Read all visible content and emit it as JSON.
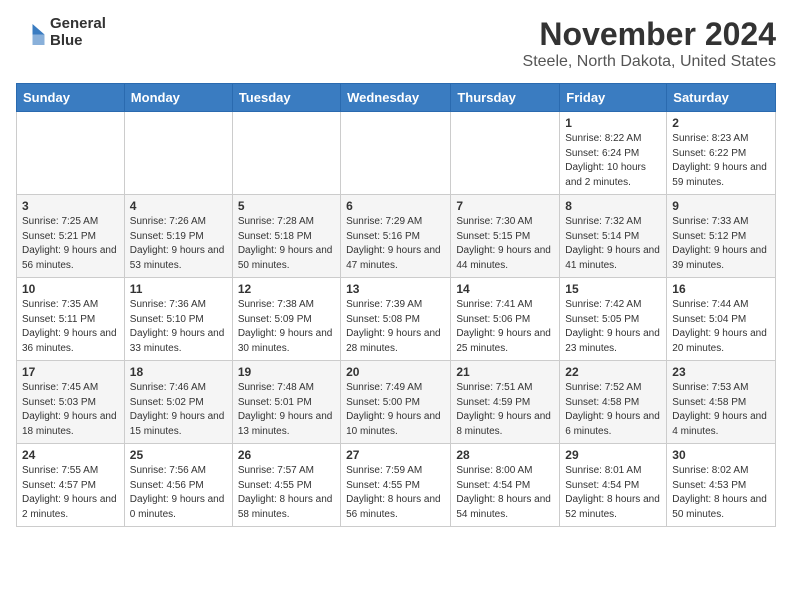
{
  "logo": {
    "name": "General Blue",
    "line1": "General",
    "line2": "Blue"
  },
  "title": "November 2024",
  "subtitle": "Steele, North Dakota, United States",
  "weekdays": [
    "Sunday",
    "Monday",
    "Tuesday",
    "Wednesday",
    "Thursday",
    "Friday",
    "Saturday"
  ],
  "weeks": [
    [
      {
        "day": "",
        "info": ""
      },
      {
        "day": "",
        "info": ""
      },
      {
        "day": "",
        "info": ""
      },
      {
        "day": "",
        "info": ""
      },
      {
        "day": "",
        "info": ""
      },
      {
        "day": "1",
        "info": "Sunrise: 8:22 AM\nSunset: 6:24 PM\nDaylight: 10 hours and 2 minutes."
      },
      {
        "day": "2",
        "info": "Sunrise: 8:23 AM\nSunset: 6:22 PM\nDaylight: 9 hours and 59 minutes."
      }
    ],
    [
      {
        "day": "3",
        "info": "Sunrise: 7:25 AM\nSunset: 5:21 PM\nDaylight: 9 hours and 56 minutes."
      },
      {
        "day": "4",
        "info": "Sunrise: 7:26 AM\nSunset: 5:19 PM\nDaylight: 9 hours and 53 minutes."
      },
      {
        "day": "5",
        "info": "Sunrise: 7:28 AM\nSunset: 5:18 PM\nDaylight: 9 hours and 50 minutes."
      },
      {
        "day": "6",
        "info": "Sunrise: 7:29 AM\nSunset: 5:16 PM\nDaylight: 9 hours and 47 minutes."
      },
      {
        "day": "7",
        "info": "Sunrise: 7:30 AM\nSunset: 5:15 PM\nDaylight: 9 hours and 44 minutes."
      },
      {
        "day": "8",
        "info": "Sunrise: 7:32 AM\nSunset: 5:14 PM\nDaylight: 9 hours and 41 minutes."
      },
      {
        "day": "9",
        "info": "Sunrise: 7:33 AM\nSunset: 5:12 PM\nDaylight: 9 hours and 39 minutes."
      }
    ],
    [
      {
        "day": "10",
        "info": "Sunrise: 7:35 AM\nSunset: 5:11 PM\nDaylight: 9 hours and 36 minutes."
      },
      {
        "day": "11",
        "info": "Sunrise: 7:36 AM\nSunset: 5:10 PM\nDaylight: 9 hours and 33 minutes."
      },
      {
        "day": "12",
        "info": "Sunrise: 7:38 AM\nSunset: 5:09 PM\nDaylight: 9 hours and 30 minutes."
      },
      {
        "day": "13",
        "info": "Sunrise: 7:39 AM\nSunset: 5:08 PM\nDaylight: 9 hours and 28 minutes."
      },
      {
        "day": "14",
        "info": "Sunrise: 7:41 AM\nSunset: 5:06 PM\nDaylight: 9 hours and 25 minutes."
      },
      {
        "day": "15",
        "info": "Sunrise: 7:42 AM\nSunset: 5:05 PM\nDaylight: 9 hours and 23 minutes."
      },
      {
        "day": "16",
        "info": "Sunrise: 7:44 AM\nSunset: 5:04 PM\nDaylight: 9 hours and 20 minutes."
      }
    ],
    [
      {
        "day": "17",
        "info": "Sunrise: 7:45 AM\nSunset: 5:03 PM\nDaylight: 9 hours and 18 minutes."
      },
      {
        "day": "18",
        "info": "Sunrise: 7:46 AM\nSunset: 5:02 PM\nDaylight: 9 hours and 15 minutes."
      },
      {
        "day": "19",
        "info": "Sunrise: 7:48 AM\nSunset: 5:01 PM\nDaylight: 9 hours and 13 minutes."
      },
      {
        "day": "20",
        "info": "Sunrise: 7:49 AM\nSunset: 5:00 PM\nDaylight: 9 hours and 10 minutes."
      },
      {
        "day": "21",
        "info": "Sunrise: 7:51 AM\nSunset: 4:59 PM\nDaylight: 9 hours and 8 minutes."
      },
      {
        "day": "22",
        "info": "Sunrise: 7:52 AM\nSunset: 4:58 PM\nDaylight: 9 hours and 6 minutes."
      },
      {
        "day": "23",
        "info": "Sunrise: 7:53 AM\nSunset: 4:58 PM\nDaylight: 9 hours and 4 minutes."
      }
    ],
    [
      {
        "day": "24",
        "info": "Sunrise: 7:55 AM\nSunset: 4:57 PM\nDaylight: 9 hours and 2 minutes."
      },
      {
        "day": "25",
        "info": "Sunrise: 7:56 AM\nSunset: 4:56 PM\nDaylight: 9 hours and 0 minutes."
      },
      {
        "day": "26",
        "info": "Sunrise: 7:57 AM\nSunset: 4:55 PM\nDaylight: 8 hours and 58 minutes."
      },
      {
        "day": "27",
        "info": "Sunrise: 7:59 AM\nSunset: 4:55 PM\nDaylight: 8 hours and 56 minutes."
      },
      {
        "day": "28",
        "info": "Sunrise: 8:00 AM\nSunset: 4:54 PM\nDaylight: 8 hours and 54 minutes."
      },
      {
        "day": "29",
        "info": "Sunrise: 8:01 AM\nSunset: 4:54 PM\nDaylight: 8 hours and 52 minutes."
      },
      {
        "day": "30",
        "info": "Sunrise: 8:02 AM\nSunset: 4:53 PM\nDaylight: 8 hours and 50 minutes."
      }
    ]
  ]
}
